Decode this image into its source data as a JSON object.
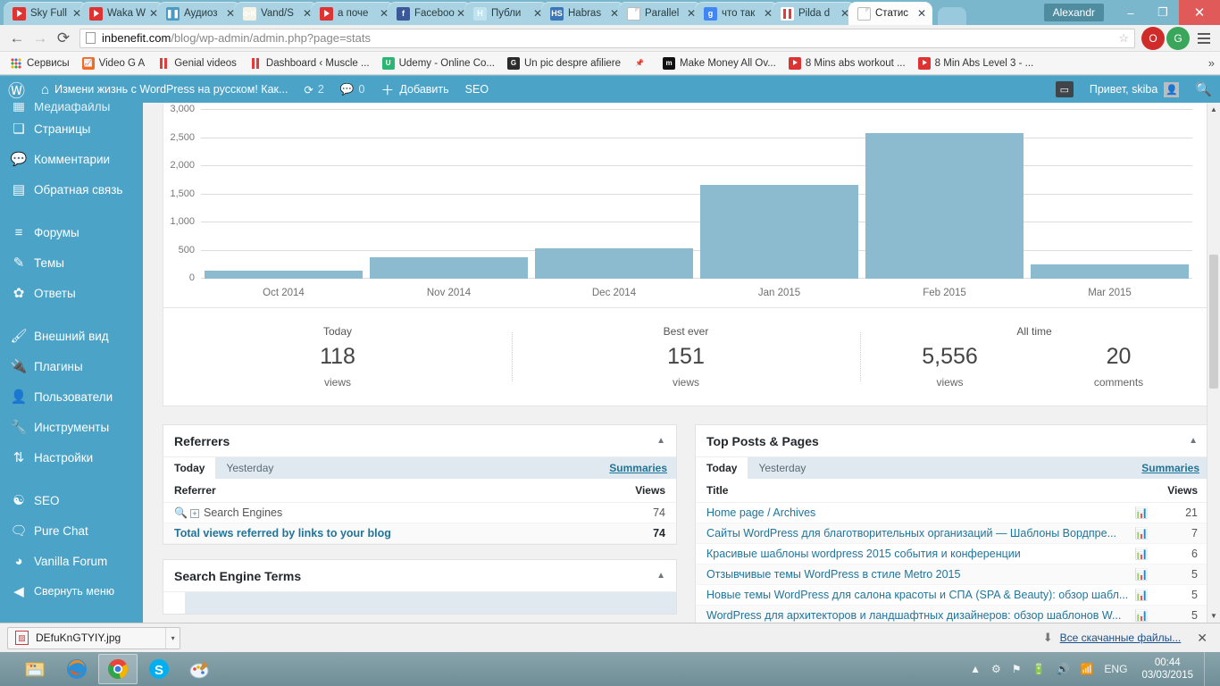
{
  "browser": {
    "tabs": [
      {
        "label": "Sky Full",
        "icon": "youtube-icon",
        "active": false
      },
      {
        "label": "Waka W",
        "icon": "youtube-icon",
        "active": false
      },
      {
        "label": "Аудиоз",
        "icon": "pause-icon",
        "active": false
      },
      {
        "label": "Vand/S",
        "icon": "vk-icon",
        "active": false
      },
      {
        "label": "а поче",
        "icon": "youtube-icon",
        "active": false
      },
      {
        "label": "Faceboo",
        "icon": "facebook-icon",
        "active": false
      },
      {
        "label": "Публи",
        "icon": "habr-icon",
        "active": false
      },
      {
        "label": "Habras",
        "icon": "hs-icon",
        "active": false
      },
      {
        "label": "Parallel",
        "icon": "document-icon",
        "active": false
      },
      {
        "label": "что так",
        "icon": "google-icon",
        "active": false
      },
      {
        "label": "Pilda d",
        "icon": "pilda-icon",
        "active": false
      },
      {
        "label": "Статис",
        "icon": "document-icon",
        "active": true
      }
    ],
    "close_label": "✕",
    "window": {
      "user": "Alexandr",
      "minimize": "–",
      "restore": "❐",
      "close": "✕"
    },
    "toolbar": {
      "back": "←",
      "forward": "→",
      "reload": "⟳",
      "url_domain": "inbenefit.com",
      "url_path": "/blog/wp-admin/admin.php?page=stats",
      "star": "☆",
      "menu": "menu"
    },
    "bookmarks": [
      {
        "label": "Сервисы",
        "icon": "apps-grid-icon"
      },
      {
        "label": "Video G A",
        "icon": "chart-orange-icon"
      },
      {
        "label": "Genial videos",
        "icon": "red-bars-icon"
      },
      {
        "label": "Dashboard ‹ Muscle ...",
        "icon": "red-bars-icon"
      },
      {
        "label": "Udemy - Online Co...",
        "icon": "udemy-icon"
      },
      {
        "label": "Un pic despre afiliere",
        "icon": "google-black-icon"
      },
      {
        "label": "",
        "icon": "pin-icon"
      },
      {
        "label": "Make Money All Ov...",
        "icon": "m-black-icon"
      },
      {
        "label": "8 Mins abs workout ...",
        "icon": "youtube-icon"
      },
      {
        "label": "8 Min Abs Level 3 - ...",
        "icon": "youtube-icon"
      }
    ],
    "bookmarks_overflow": "»"
  },
  "adminbar": {
    "logo": "wordpress-logo",
    "site_name": "Измени жизнь с WordPress на русском! Как...",
    "updates_count": "2",
    "comments_count": "0",
    "new_label": "Добавить",
    "seo_label": "SEO",
    "greeting": "Привет, skiba",
    "search": "search-icon"
  },
  "sidebar": {
    "items": [
      {
        "label": "Медиафайлы",
        "icon": "media-icon",
        "partial": true
      },
      {
        "label": "Страницы",
        "icon": "pages-icon"
      },
      {
        "label": "Комментарии",
        "icon": "comments-icon"
      },
      {
        "label": "Обратная связь",
        "icon": "feedback-icon"
      },
      {
        "sep": true
      },
      {
        "label": "Форумы",
        "icon": "forums-icon"
      },
      {
        "label": "Темы",
        "icon": "topics-icon"
      },
      {
        "label": "Ответы",
        "icon": "replies-icon"
      },
      {
        "sep": true
      },
      {
        "label": "Внешний вид",
        "icon": "appearance-icon"
      },
      {
        "label": "Плагины",
        "icon": "plugins-icon"
      },
      {
        "label": "Пользователи",
        "icon": "users-icon"
      },
      {
        "label": "Инструменты",
        "icon": "tools-icon"
      },
      {
        "label": "Настройки",
        "icon": "settings-icon"
      },
      {
        "sep": true
      },
      {
        "label": "SEO",
        "icon": "seo-icon"
      },
      {
        "label": "Pure Chat",
        "icon": "purechat-icon"
      },
      {
        "label": "Vanilla Forum",
        "icon": "vanilla-icon"
      },
      {
        "label": "Свернуть меню",
        "icon": "collapse-icon"
      }
    ]
  },
  "chart_data": {
    "type": "bar",
    "title": "",
    "xlabel": "",
    "ylabel": "",
    "categories": [
      "Oct 2014",
      "Nov 2014",
      "Dec 2014",
      "Jan 2015",
      "Feb 2015",
      "Mar 2015"
    ],
    "values": [
      140,
      380,
      540,
      1670,
      2580,
      250
    ],
    "yticks": [
      "0",
      "500",
      "1,000",
      "1,500",
      "2,000",
      "2,500",
      "3,000"
    ],
    "ytick_values": [
      0,
      500,
      1000,
      1500,
      2000,
      2500,
      3000
    ],
    "ylim": [
      0,
      3000
    ],
    "grid": true,
    "legend": "none",
    "bar_color": "#8cbacf",
    "series": [
      {
        "name": "Views",
        "values": [
          140,
          380,
          540,
          1670,
          2580,
          250
        ]
      }
    ]
  },
  "summary": {
    "cells": [
      {
        "label": "Today",
        "value": "118",
        "unit": "views"
      },
      {
        "label": "Best ever",
        "value": "151",
        "unit": "views"
      },
      {
        "label": "All time",
        "value": "5,556",
        "unit": "views",
        "value2": "20",
        "unit2": "comments"
      }
    ]
  },
  "referrers": {
    "title": "Referrers",
    "toggle": "▲",
    "tabs": [
      {
        "label": "Today",
        "active": true
      },
      {
        "label": "Yesterday",
        "active": false
      }
    ],
    "summaries": "Summaries",
    "columns": [
      "Referrer",
      "Views"
    ],
    "rows": [
      {
        "label": "Search Engines",
        "views": "74",
        "expandable": true
      }
    ],
    "total_label": "Total views referred by links to your blog",
    "total_views": "74"
  },
  "search_engine_terms": {
    "title": "Search Engine Terms",
    "toggle": "▲"
  },
  "top_posts": {
    "title": "Top Posts & Pages",
    "toggle": "▲",
    "tabs": [
      {
        "label": "Today",
        "active": true
      },
      {
        "label": "Yesterday",
        "active": false
      }
    ],
    "summaries": "Summaries",
    "columns": [
      "Title",
      "Views"
    ],
    "rows": [
      {
        "title": "Home page / Archives",
        "views": "21"
      },
      {
        "title": "Сайты WordPress для благотворительных организаций — Шаблоны Вордпре...",
        "views": "7"
      },
      {
        "title": "Красивые шаблоны wordpress 2015 события и конференции",
        "views": "6"
      },
      {
        "title": "Отзывчивые темы WordPress в стиле Metro 2015",
        "views": "5"
      },
      {
        "title": "Новые темы WordPress для салона красоты и СПА (SPA & Beauty): обзор шабл...",
        "views": "5"
      },
      {
        "title": "WordPress для архитекторов и ландшафтных дизайнеров: обзор шаблонов W...",
        "views": "5"
      }
    ]
  },
  "downloads": {
    "file_name": "DEfuKnGTYIY.jpg",
    "caret": "▾",
    "show_all": "Все скачанные файлы...",
    "arrow": "⬇",
    "close": "✕"
  },
  "taskbar": {
    "buttons": [
      {
        "name": "explorer",
        "active": false
      },
      {
        "name": "firefox",
        "active": false
      },
      {
        "name": "chrome",
        "active": true
      },
      {
        "name": "skype",
        "active": false
      },
      {
        "name": "paint",
        "active": false
      }
    ],
    "tray": {
      "expand": "▲",
      "language": "ENG",
      "time": "00:44",
      "date": "03/03/2015"
    }
  }
}
